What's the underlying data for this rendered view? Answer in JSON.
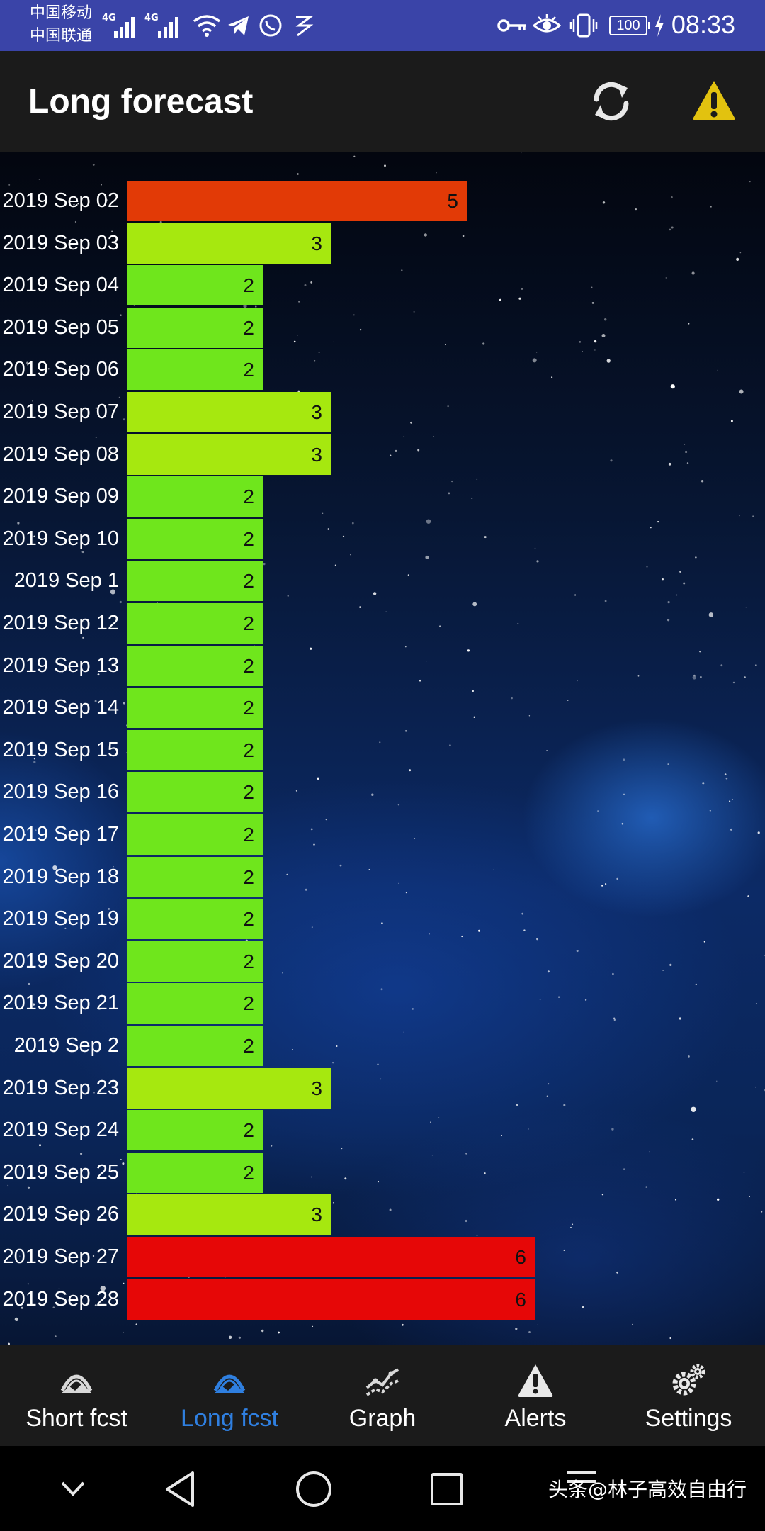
{
  "status_bar": {
    "carrier_1": "中国移动",
    "carrier_2": "中国联通",
    "network_1": "4G",
    "network_2": "4G",
    "battery": "100",
    "time": "08:33"
  },
  "app_bar": {
    "title": "Long forecast",
    "actions": [
      "refresh-icon",
      "warning-icon"
    ],
    "warning_color": "#e2c20f"
  },
  "chart_data": {
    "type": "bar",
    "orientation": "horizontal",
    "categories": [
      "2019 Sep 02",
      "2019 Sep 03",
      "2019 Sep 04",
      "2019 Sep 05",
      "2019 Sep 06",
      "2019 Sep 07",
      "2019 Sep 08",
      "2019 Sep 09",
      "2019 Sep 10",
      "2019 Sep 1",
      "2019 Sep 12",
      "2019 Sep 13",
      "2019 Sep 14",
      "2019 Sep 15",
      "2019 Sep 16",
      "2019 Sep 17",
      "2019 Sep 18",
      "2019 Sep 19",
      "2019 Sep 20",
      "2019 Sep 21",
      "2019 Sep 2",
      "2019 Sep 23",
      "2019 Sep 24",
      "2019 Sep 25",
      "2019 Sep 26",
      "2019 Sep 27",
      "2019 Sep 28"
    ],
    "values": [
      5,
      3,
      2,
      2,
      2,
      3,
      3,
      2,
      2,
      2,
      2,
      2,
      2,
      2,
      2,
      2,
      2,
      2,
      2,
      2,
      2,
      3,
      2,
      2,
      3,
      6,
      6
    ],
    "xlim": [
      0,
      9
    ],
    "grid": true,
    "title": "",
    "xlabel": "",
    "ylabel": "",
    "level_colors": {
      "2": "#6fe61c",
      "3": "#a6e80f",
      "5": "#e23a06",
      "6": "#e60707"
    }
  },
  "bottom_nav": {
    "active_index": 1,
    "active_color": "#2f7fe0",
    "items": [
      {
        "label": "Short fcst",
        "icon": "aurora-icon"
      },
      {
        "label": "Long fcst",
        "icon": "aurora-icon"
      },
      {
        "label": "Graph",
        "icon": "graph-icon"
      },
      {
        "label": "Alerts",
        "icon": "alert-icon"
      },
      {
        "label": "Settings",
        "icon": "gear-icon"
      }
    ]
  },
  "system_nav": {
    "buttons": [
      "chevron-down-icon",
      "back-icon",
      "home-icon",
      "recents-icon",
      "menu-icon"
    ],
    "watermark": "头条@林子高效自由行"
  }
}
